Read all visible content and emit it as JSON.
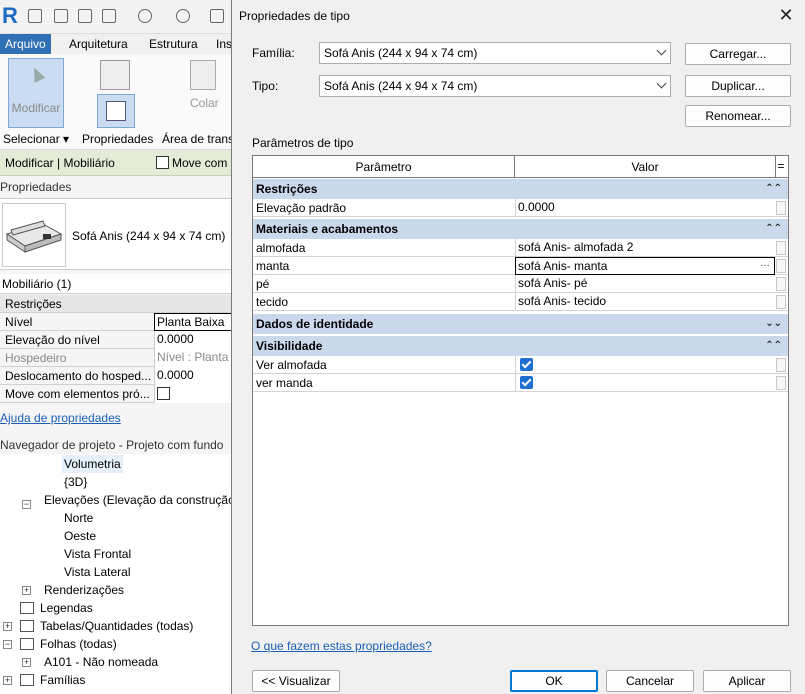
{
  "background": {
    "ribbon_tabs": [
      "Arquivo",
      "Arquitetura",
      "Estrutura",
      "Ins"
    ],
    "ribbon": {
      "modify_label": "Modificar",
      "colar_label": "Colar",
      "selecionar": "Selecionar ▾",
      "propriedades": "Propriedades",
      "area_trans": "Área de trans"
    },
    "context_bar": {
      "title": "Modificar | Mobiliário",
      "move_with": "Move com"
    },
    "properties": {
      "title": "Propriedades",
      "type_name": "Sofá Anis (244 x 94 x 74 cm)",
      "category": "Mobiliário (1)",
      "group": "Restrições",
      "rows": [
        {
          "label": "Nível",
          "value": "Planta Baixa"
        },
        {
          "label": "Elevação do nível",
          "value": "0.0000"
        },
        {
          "label": "Hospedeiro",
          "value": "Nível : Planta B"
        },
        {
          "label": "Deslocamento do hosped...",
          "value": "0.0000"
        },
        {
          "label": "Move com elementos pró...",
          "value": ""
        }
      ],
      "help_link": "Ajuda de propriedades"
    },
    "navigator": {
      "title": "Navegador de projeto - Projeto com fundo",
      "items": [
        "Volumetria",
        "{3D}",
        "Elevações (Elevação da construção)",
        "Norte",
        "Oeste",
        "Vista Frontal",
        "Vista Lateral",
        "Renderizações",
        "Legendas",
        "Tabelas/Quantidades (todas)",
        "Folhas (todas)",
        "A101 - Não nomeada",
        "Famílias"
      ]
    }
  },
  "dialog": {
    "title": "Propriedades de tipo",
    "familia_label": "Família:",
    "familia_value": "Sofá Anis (244 x 94 x 74 cm)",
    "tipo_label": "Tipo:",
    "tipo_value": "Sofá Anis (244 x 94 x 74 cm)",
    "btn_carregar": "Carregar...",
    "btn_duplicar": "Duplicar...",
    "btn_renomear": "Renomear...",
    "section_label": "Parâmetros de tipo",
    "col_param": "Parâmetro",
    "col_valor": "Valor",
    "col_extra": "=",
    "groups": {
      "restricoes": "Restrições",
      "materiais": "Materiais e acabamentos",
      "identidade": "Dados de identidade",
      "visibilidade": "Visibilidade"
    },
    "rows": {
      "elevacao": {
        "p": "Elevação padrão",
        "v": "0.0000"
      },
      "almofada": {
        "p": "almofada",
        "v": "sofá Anis- almofada 2"
      },
      "manta": {
        "p": "manta",
        "v": "sofá Anis- manta"
      },
      "pe": {
        "p": "pé",
        "v": "sofá Anis- pé"
      },
      "tecido": {
        "p": "tecido",
        "v": "sofá Anis- tecido"
      },
      "ver_almofada": {
        "p": "Ver almofada",
        "checked": true
      },
      "ver_manda": {
        "p": "ver manda",
        "checked": true
      }
    },
    "collapse_icon": "double-chevron-up",
    "expand_icon": "double-chevron-down",
    "help_link": "O que fazem estas propriedades?",
    "btn_visualizar": "<< Visualizar",
    "btn_ok": "OK",
    "btn_cancelar": "Cancelar",
    "btn_aplicar": "Aplicar"
  }
}
